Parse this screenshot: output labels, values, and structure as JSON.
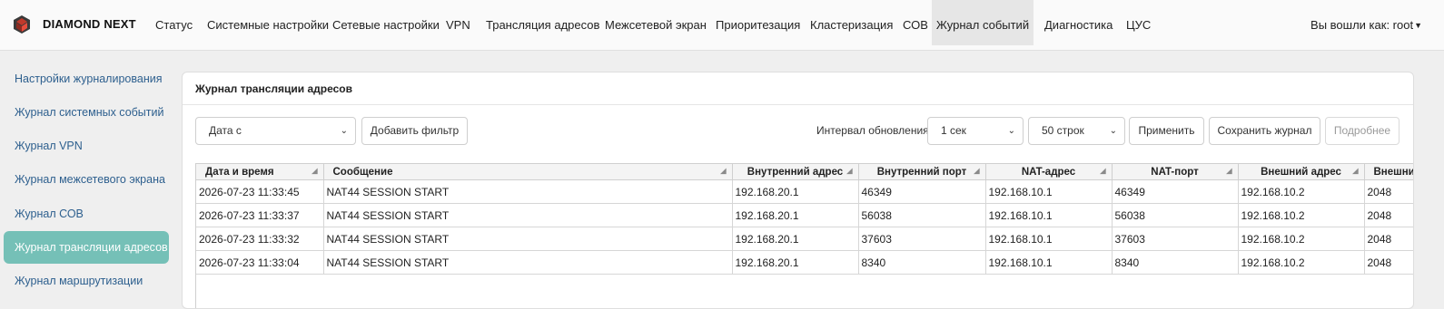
{
  "brand": {
    "name": "DIAMOND NEXT"
  },
  "nav": {
    "items": [
      {
        "label": "Статус"
      },
      {
        "label": "Системные настройки"
      },
      {
        "label": "Сетевые настройки"
      },
      {
        "label": "VPN"
      },
      {
        "label": "Трансляция адресов"
      },
      {
        "label": "Межсетевой экран"
      },
      {
        "label": "Приоритезация"
      },
      {
        "label": "Кластеризация"
      },
      {
        "label": "СОВ"
      },
      {
        "label": "Журнал событий"
      },
      {
        "label": "Диагностика"
      },
      {
        "label": "ЦУС"
      }
    ],
    "active": "Журнал событий",
    "user_label": "Вы вошли как: root"
  },
  "sidebar": {
    "items": [
      {
        "label": "Настройки журналирования"
      },
      {
        "label": "Журнал системных событий"
      },
      {
        "label": "Журнал VPN"
      },
      {
        "label": "Журнал межсетевого экрана"
      },
      {
        "label": "Журнал СОВ"
      },
      {
        "label": "Журнал трансляции адресов"
      },
      {
        "label": "Журнал маршрутизации"
      }
    ],
    "active": "Журнал трансляции адресов"
  },
  "panel": {
    "title": "Журнал трансляции адресов",
    "filter_select": "Дата с",
    "add_filter": "Добавить фильтр",
    "refresh_label": "Интервал обновления",
    "refresh_value": "1 сек",
    "rows_value": "50 строк",
    "apply": "Применить",
    "save_log": "Сохранить журнал",
    "details": "Подробнее"
  },
  "table": {
    "columns": [
      "Дата и время",
      "Сообщение",
      "Внутренний адрес",
      "Внутренний порт",
      "NAT-адрес",
      "NAT-порт",
      "Внешний адрес",
      "Внешний порт"
    ],
    "rows": [
      [
        "2026-07-23 11:33:45",
        "NAT44 SESSION START",
        "192.168.20.1",
        "46349",
        "192.168.10.1",
        "46349",
        "192.168.10.2",
        "2048"
      ],
      [
        "2026-07-23 11:33:37",
        "NAT44 SESSION START",
        "192.168.20.1",
        "56038",
        "192.168.10.1",
        "56038",
        "192.168.10.2",
        "2048"
      ],
      [
        "2026-07-23 11:33:32",
        "NAT44 SESSION START",
        "192.168.20.1",
        "37603",
        "192.168.10.1",
        "37603",
        "192.168.10.2",
        "2048"
      ],
      [
        "2026-07-23 11:33:04",
        "NAT44 SESSION START",
        "192.168.20.1",
        "8340",
        "192.168.10.1",
        "8340",
        "192.168.10.2",
        "2048"
      ]
    ]
  },
  "colors": {
    "accent": "#75c0b7",
    "link": "#2d5f8e",
    "logo": "#c0392b"
  },
  "icons": {
    "logo": "diamond-logo-icon",
    "sort": "sort-icon",
    "dropdown": "chevron-down-icon"
  }
}
